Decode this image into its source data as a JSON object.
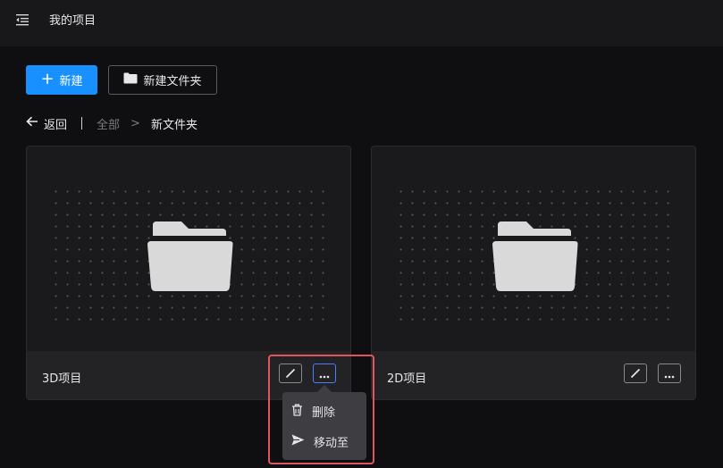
{
  "header": {
    "title": "我的项目",
    "menu_icon": "menu-fold-icon"
  },
  "toolbar": {
    "new_label": "新建",
    "new_folder_label": "新建文件夹"
  },
  "breadcrumb": {
    "back_label": "返回",
    "all_label": "全部",
    "separator": ">",
    "current_label": "新文件夹"
  },
  "cards": [
    {
      "name": "3D项目"
    },
    {
      "name": "2D项目"
    }
  ],
  "dropdown": {
    "items": [
      {
        "label": "删除",
        "icon": "trash-icon"
      },
      {
        "label": "移动至",
        "icon": "send-icon"
      }
    ]
  },
  "colors": {
    "accent": "#1890ff",
    "highlight": "#e0565f",
    "active_border": "#4a7dff"
  }
}
